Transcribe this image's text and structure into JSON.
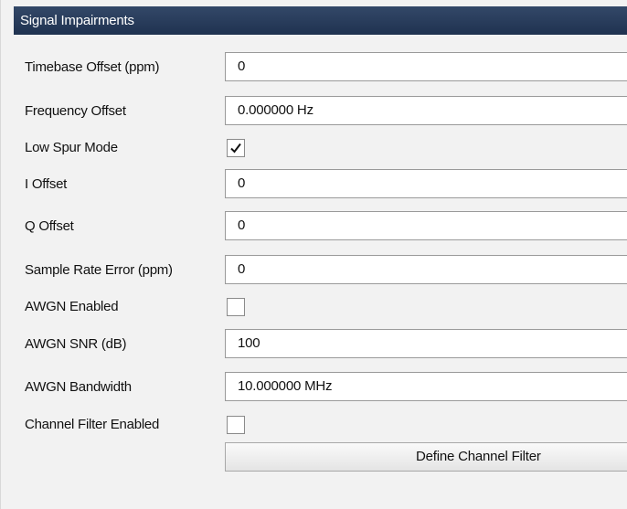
{
  "panel": {
    "title": "Signal Impairments"
  },
  "rows": [
    {
      "label": "Timebase Offset (ppm)",
      "value": "0"
    },
    {
      "label": "Frequency Offset",
      "value": "0.000000 Hz"
    },
    {
      "label": "Low Spur Mode",
      "checked": true
    },
    {
      "label": "I Offset",
      "value": "0"
    },
    {
      "label": "Q Offset",
      "value": "0"
    },
    {
      "label": "Sample Rate Error (ppm)",
      "value": "0"
    },
    {
      "label": "AWGN Enabled",
      "checked": false
    },
    {
      "label": "AWGN SNR (dB)",
      "value": "100"
    },
    {
      "label": "AWGN Bandwidth",
      "value": "10.000000 MHz"
    },
    {
      "label": "Channel Filter Enabled",
      "checked": false
    }
  ],
  "actions": {
    "define_channel_filter": "Define Channel Filter"
  }
}
